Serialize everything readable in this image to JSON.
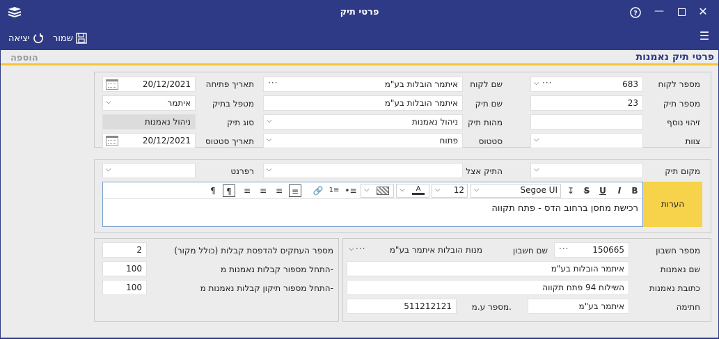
{
  "window": {
    "title": "פרטי תיק"
  },
  "toolbar": {
    "save_label": "שמור",
    "exit_label": "יציאה"
  },
  "header": {
    "title": "פרטי תיק נאמנות",
    "add_label": "הוספה"
  },
  "form": {
    "customer_no_label": "מספר לקוח",
    "customer_no": "683",
    "customer_name_label": "שם לקוח",
    "customer_name": "איתמר הובלות בע\"מ",
    "open_date_label": "תאריך פתיחה",
    "open_date": "20/12/2021",
    "case_no_label": "מספר תיק",
    "case_no": "23",
    "case_name_label": "שם תיק",
    "case_name": "איתמר הובלות בע\"מ",
    "handler_label": "מטפל בתיק",
    "handler": "איתמר",
    "extra_id_label": "זיהוי נוסף",
    "extra_id": "",
    "case_nature_label": "מהות תיק",
    "case_nature": "ניהול נאמנות",
    "case_type_label": "סוג תיק",
    "case_type": "ניהול נאמנות",
    "team_label": "צוות",
    "team": "",
    "status_label": "סטטוס",
    "status": "פתוח",
    "status_date_label": "תאריך סטטוס",
    "status_date": "20/12/2021",
    "location_label": "מקום תיק",
    "location": "",
    "held_by_label": "התיק אצל",
    "held_by": "",
    "referent_label": "רפרנט",
    "referent": "",
    "notes_label": "הערות",
    "notes": "רכישת מחסן ברחוב הדס - פתח תקווה"
  },
  "editor": {
    "font": "Segoe UI",
    "size": "12"
  },
  "account": {
    "account_no_label": "מספר חשבון",
    "account_no": "150665",
    "account_name_label": "שם חשבון",
    "account_name": "מנות הובלות איתמר בע\"מ",
    "trustee_name_label": "שם נאמנות",
    "trustee_name": "איתמר הובלות בע\"מ",
    "trustee_address_label": "כתובת נאמנות",
    "trustee_address": "השילוח 94 פתח תקווה",
    "signature_label": "חתימה",
    "signature": "איתמר בע\"מ",
    "company_no_label": "מספר ע.מ.",
    "company_no": "511212121"
  },
  "receipts": {
    "copies_label": "מספר העתקים להדפסת קבלות (כולל מקור)",
    "copies": "2",
    "start_no_label": "התחל מספור קבלות נאמנות מ-",
    "start_no": "100",
    "fix_start_label": "התחל מספור תיקון קבלות נאמנות מ-",
    "fix_start": "100"
  }
}
